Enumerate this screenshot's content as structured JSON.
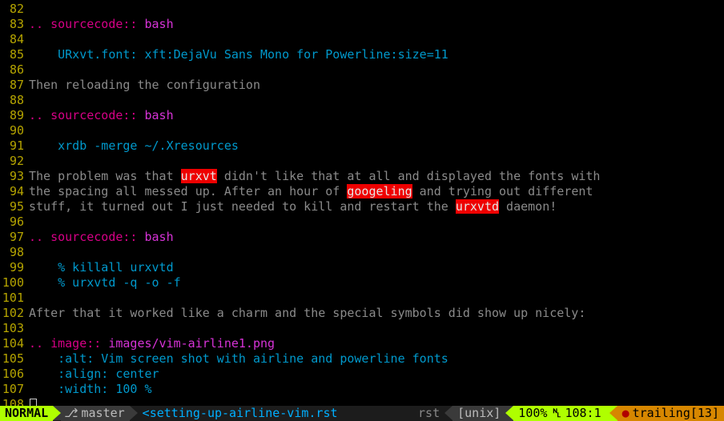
{
  "lines": [
    {
      "n": "82",
      "kind": "blank"
    },
    {
      "n": "83",
      "kind": "directive",
      "dir": ".. sourcecode::",
      "arg": "bash"
    },
    {
      "n": "84",
      "kind": "blank"
    },
    {
      "n": "85",
      "kind": "code",
      "indent": "    ",
      "code": "URxvt.font: xft:DejaVu Sans Mono for Powerline:size=11"
    },
    {
      "n": "86",
      "kind": "blank"
    },
    {
      "n": "87",
      "kind": "text",
      "text": "Then reloading the configuration"
    },
    {
      "n": "88",
      "kind": "blank"
    },
    {
      "n": "89",
      "kind": "directive",
      "dir": ".. sourcecode::",
      "arg": "bash"
    },
    {
      "n": "90",
      "kind": "blank"
    },
    {
      "n": "91",
      "kind": "code",
      "indent": "    ",
      "code": "xrdb -merge ~/.Xresources"
    },
    {
      "n": "92",
      "kind": "blank"
    },
    {
      "n": "93",
      "kind": "mixed",
      "parts": [
        {
          "t": "txt",
          "v": "The problem was that "
        },
        {
          "t": "err",
          "v": "urxvt"
        },
        {
          "t": "txt",
          "v": " didn't like that at all and displayed the fonts with"
        }
      ]
    },
    {
      "n": "94",
      "kind": "mixed",
      "parts": [
        {
          "t": "txt",
          "v": "the spacing all messed up. After an hour of "
        },
        {
          "t": "err",
          "v": "googeling"
        },
        {
          "t": "txt",
          "v": " and trying out different"
        }
      ]
    },
    {
      "n": "95",
      "kind": "mixed",
      "parts": [
        {
          "t": "txt",
          "v": "stuff, it turned out I just needed to kill and restart the "
        },
        {
          "t": "err",
          "v": "urxvtd"
        },
        {
          "t": "txt",
          "v": " daemon!"
        }
      ]
    },
    {
      "n": "96",
      "kind": "blank"
    },
    {
      "n": "97",
      "kind": "directive",
      "dir": ".. sourcecode::",
      "arg": "bash"
    },
    {
      "n": "98",
      "kind": "blank"
    },
    {
      "n": "99",
      "kind": "code",
      "indent": "    ",
      "code": "% killall urxvtd"
    },
    {
      "n": "100",
      "kind": "code",
      "indent": "    ",
      "code": "% urxvtd -q -o -f"
    },
    {
      "n": "101",
      "kind": "blank"
    },
    {
      "n": "102",
      "kind": "text",
      "text": "After that it worked like a charm and the special symbols did show up nicely:"
    },
    {
      "n": "103",
      "kind": "blank"
    },
    {
      "n": "104",
      "kind": "directive",
      "dir": ".. image::",
      "arg": "images/vim-airline1.png"
    },
    {
      "n": "105",
      "kind": "opt",
      "text": "    :alt: Vim screen shot with airline and powerline fonts"
    },
    {
      "n": "106",
      "kind": "opt",
      "text": "    :align: center"
    },
    {
      "n": "107",
      "kind": "opt",
      "text": "    :width: 100 %"
    },
    {
      "n": "108",
      "kind": "cursor"
    }
  ],
  "status": {
    "mode": "NORMAL",
    "branch_icon": "⎇",
    "branch": "master",
    "file_marker": "<",
    "filename": "setting-up-airline-vim.rst",
    "filetype": "rst",
    "fileformat": "[unix]",
    "percent": "100%",
    "ln_icon": "␤",
    "line": "108",
    "col": "1",
    "bullet": "●",
    "trail": "trailing[13]"
  }
}
